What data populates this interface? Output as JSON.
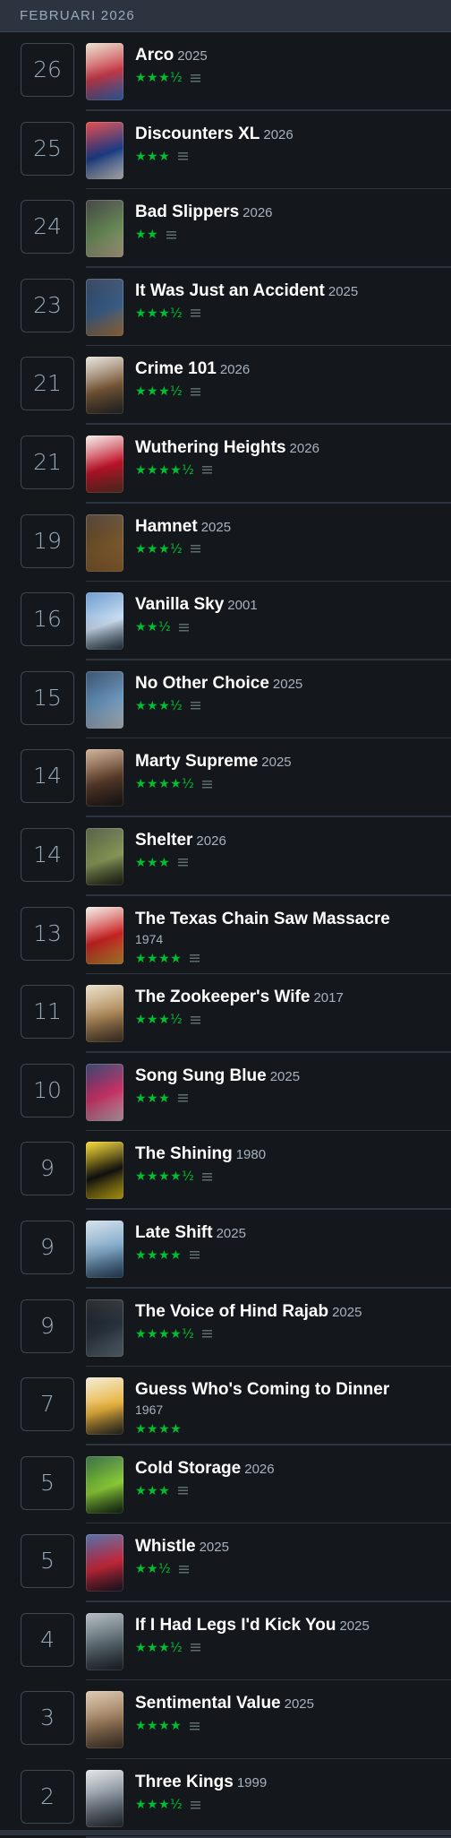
{
  "header": {
    "month": "FEBRUARI 2026"
  },
  "entries": [
    {
      "day": "26",
      "title": "Arco",
      "year": "2025",
      "stars": "★★★½",
      "review": true,
      "colors": [
        "#e9dfc8",
        "#c93a4a",
        "#3a7bd5"
      ]
    },
    {
      "day": "25",
      "title": "Discounters XL",
      "year": "2026",
      "stars": "★★★",
      "review": true,
      "colors": [
        "#d33",
        "#1b3f8b",
        "#f0f0f0"
      ]
    },
    {
      "day": "24",
      "title": "Bad Slippers",
      "year": "2026",
      "stars": "★★",
      "review": true,
      "colors": [
        "#2b2b2b",
        "#6b8e5a",
        "#d8c9a6"
      ]
    },
    {
      "day": "23",
      "title": "It Was Just an Accident",
      "year": "2025",
      "stars": "★★★½",
      "review": true,
      "colors": [
        "#1c2e4a",
        "#3c5f87",
        "#c58a4e"
      ]
    },
    {
      "day": "21",
      "title": "Crime 101",
      "year": "2026",
      "stars": "★★★½",
      "review": true,
      "colors": [
        "#e7e2da",
        "#7a5a3a",
        "#2d2d2d"
      ]
    },
    {
      "day": "21",
      "title": "Wuthering Heights",
      "year": "2026",
      "stars": "★★★★½",
      "review": true,
      "colors": [
        "#f4eee8",
        "#c2122a",
        "#6b3a2a"
      ]
    },
    {
      "day": "19",
      "title": "Hamnet",
      "year": "2025",
      "stars": "★★★½",
      "review": true,
      "colors": [
        "#3b2a1c",
        "#7b5a2e",
        "#a8743a"
      ]
    },
    {
      "day": "16",
      "title": "Vanilla Sky",
      "year": "2001",
      "stars": "★★½",
      "review": true,
      "colors": [
        "#5a8fc9",
        "#cfe2f5",
        "#2a3a4a"
      ]
    },
    {
      "day": "15",
      "title": "No Other Choice",
      "year": "2025",
      "stars": "★★★½",
      "review": true,
      "colors": [
        "#1f3b5c",
        "#6f9bc2",
        "#dce6ee"
      ]
    },
    {
      "day": "14",
      "title": "Marty Supreme",
      "year": "2025",
      "stars": "★★★★½",
      "review": true,
      "colors": [
        "#caa88a",
        "#5a3b2a",
        "#1b1b1b"
      ]
    },
    {
      "day": "14",
      "title": "Shelter",
      "year": "2026",
      "stars": "★★★",
      "review": true,
      "colors": [
        "#3e4a2e",
        "#8a9a5a",
        "#1d2317"
      ]
    },
    {
      "day": "13",
      "title": "The Texas Chain Saw Massacre",
      "year": "1974",
      "stars": "★★★★",
      "review": true,
      "twoLine": true,
      "colors": [
        "#f2efe9",
        "#c22",
        "#e9a33a"
      ]
    },
    {
      "day": "11",
      "title": "The Zookeeper's Wife",
      "year": "2017",
      "stars": "★★★½",
      "review": true,
      "colors": [
        "#e8dcc4",
        "#b08a5a",
        "#4a3a2a"
      ]
    },
    {
      "day": "10",
      "title": "Song Sung Blue",
      "year": "2025",
      "stars": "★★★",
      "review": true,
      "colors": [
        "#1b2a5a",
        "#d0356a",
        "#f0c8d8"
      ]
    },
    {
      "day": "9",
      "title": "The Shining",
      "year": "1980",
      "stars": "★★★★½",
      "review": true,
      "colors": [
        "#f7d518",
        "#111",
        "#f7d518"
      ]
    },
    {
      "day": "9",
      "title": "Late Shift",
      "year": "2025",
      "stars": "★★★★",
      "review": true,
      "colors": [
        "#cfdde9",
        "#7fa8c8",
        "#2b4a6a"
      ]
    },
    {
      "day": "9",
      "title": "The Voice of Hind Rajab",
      "year": "2025",
      "stars": "★★★★½",
      "review": true,
      "colors": [
        "#0b0e12",
        "#2a3540",
        "#6f7f8c"
      ]
    },
    {
      "day": "7",
      "title": "Guess Who's Coming to Dinner",
      "year": "1967",
      "stars": "★★★★",
      "review": false,
      "twoLine": true,
      "colors": [
        "#f3e9d0",
        "#e8b23a",
        "#2a2a2a"
      ]
    },
    {
      "day": "5",
      "title": "Cold Storage",
      "year": "2026",
      "stars": "★★★",
      "review": true,
      "colors": [
        "#1e5a2a",
        "#8fcf3a",
        "#0f2a14"
      ]
    },
    {
      "day": "5",
      "title": "Whistle",
      "year": "2025",
      "stars": "★★½",
      "review": true,
      "colors": [
        "#3a5a9a",
        "#c8283a",
        "#1a1a2a"
      ]
    },
    {
      "day": "4",
      "title": "If I Had Legs I'd Kick You",
      "year": "2025",
      "stars": "★★★½",
      "review": true,
      "colors": [
        "#a8b2b8",
        "#5a6870",
        "#202830"
      ]
    },
    {
      "day": "3",
      "title": "Sentimental Value",
      "year": "2025",
      "stars": "★★★★",
      "review": true,
      "colors": [
        "#d9c2a8",
        "#9a7a5a",
        "#4a3a2e"
      ]
    },
    {
      "day": "2",
      "title": "Three Kings",
      "year": "1999",
      "stars": "★★★½",
      "review": true,
      "colors": [
        "#e0e3e6",
        "#7a8590",
        "#2a3038"
      ]
    }
  ]
}
